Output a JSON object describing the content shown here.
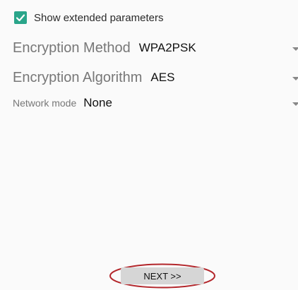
{
  "options": {
    "show_extended_label": "Show extended parameters",
    "show_extended_checked": true
  },
  "settings": [
    {
      "label": "Encryption Method",
      "value": "WPA2PSK"
    },
    {
      "label": "Encryption Algorithm",
      "value": "AES"
    },
    {
      "label": "Network mode",
      "value": "None"
    }
  ],
  "footer": {
    "next_label": "NEXT >>"
  },
  "colors": {
    "checkbox": "#2aa58a",
    "highlight_ellipse": "#b3262b",
    "button_bg": "#d6d6d6"
  }
}
